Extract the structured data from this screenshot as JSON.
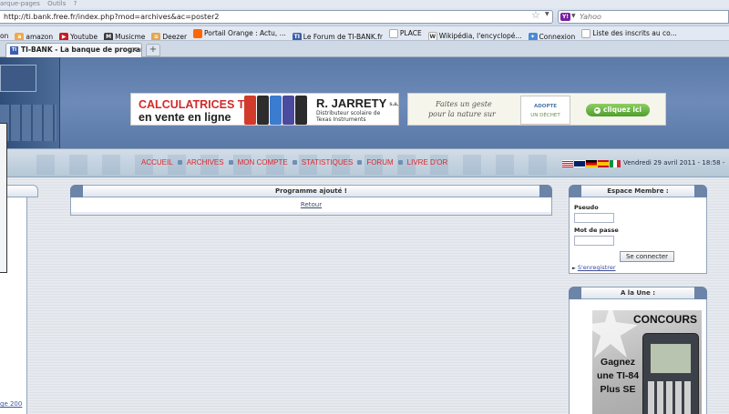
{
  "browser": {
    "menu": [
      "arque-pages",
      "Outils",
      "?"
    ],
    "url": "http://ti.bank.free.fr/index.php?mod=archives&ac=poster2",
    "search_placeholder": "Yahoo",
    "search_engine_icon": "Y!",
    "bookmarks": [
      {
        "label": "on",
        "icon": "",
        "color": "#ffffff"
      },
      {
        "label": "amazon",
        "icon": "a",
        "color": "#f3a847"
      },
      {
        "label": "Youtube",
        "icon": "▶",
        "color": "#cc181e"
      },
      {
        "label": "Musicme",
        "icon": "M",
        "color": "#3a3a3a"
      },
      {
        "label": "Deezer",
        "icon": "≡",
        "color": "#e5a54a"
      },
      {
        "label": "Portail Orange : Actu, ...",
        "icon": "",
        "color": "#ff6600"
      },
      {
        "label": "Le Forum de TI-BANK.fr",
        "icon": "TI",
        "color": "#3b5fae"
      },
      {
        "label": "PLACE",
        "icon": "",
        "color": "#ffffff"
      },
      {
        "label": "Wikipédia, l'encyclopé...",
        "icon": "W",
        "color": "#ffffff"
      },
      {
        "label": "Connexion",
        "icon": "✦",
        "color": "#4a8bd6"
      },
      {
        "label": "Liste des inscrits au co...",
        "icon": "",
        "color": "#ffffff"
      }
    ],
    "tab": {
      "title": "TI-BANK - La banque de program...",
      "favicon": "TI",
      "close": "×"
    },
    "new_tab": "+"
  },
  "ads": {
    "jarrety": {
      "line1": "CALCULATRICES TI",
      "line2": "en vente en ligne",
      "brand": "R. JARRETY",
      "brand_suffix": "s.a.",
      "sub1": "Distributeur scolaire de",
      "sub2": "Texas Instruments",
      "calc_colors": [
        "#d23b2b",
        "#2d2d2d",
        "#3b7bd0",
        "#4a4a9e",
        "#2c2c2c"
      ]
    },
    "adopte": {
      "text1": "Faites un geste",
      "text2": "pour la nature sur",
      "logo1": "ADOPTE",
      "logo2": "UN DÉCHET",
      "button": "cliquez ici"
    }
  },
  "nav": {
    "links": [
      "ACCUEIL",
      "ARCHIVES",
      "MON COMPTE",
      "STATISTIQUES",
      "FORUM",
      "LIVRE D'OR"
    ],
    "date": "Vendredi 29 avril 2011 - 18:58 -",
    "flags": [
      "us",
      "uk",
      "de",
      "es",
      "it"
    ]
  },
  "center": {
    "title": "Programme ajouté !",
    "link": "Retour"
  },
  "member": {
    "title": "Espace Membre :",
    "pseudo_label": "Pseudo",
    "password_label": "Mot de passe",
    "login_button": "Se connecter",
    "register": "S'enregistrer"
  },
  "une": {
    "title": "A la Une :",
    "image_title": "CONCOURS",
    "image_text": "Gagnez une TI-84 Plus SE"
  },
  "left": {
    "link": "ge 200"
  }
}
